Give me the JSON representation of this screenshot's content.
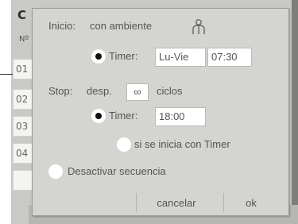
{
  "background": {
    "header": "C",
    "subheader": "Nº",
    "rows": [
      "01",
      "02",
      "03",
      "04",
      ""
    ]
  },
  "dialog": {
    "start_label": "Inicio:",
    "start_value": "con ambiente",
    "ambient_icon": "person-icon",
    "timer_label": "Timer:",
    "start_days": "Lu-Vie",
    "start_time": "07:30",
    "stop_label": "Stop:",
    "after_label": "desp.",
    "cycles_value": "∞",
    "cycles_label": "ciclos",
    "stop_time": "18:00",
    "only_if_timer_label": "si se inicia con Timer",
    "deactivate_label": "Desactivar secuencia",
    "cancel_label": "cancelar",
    "ok_label": "ok"
  }
}
